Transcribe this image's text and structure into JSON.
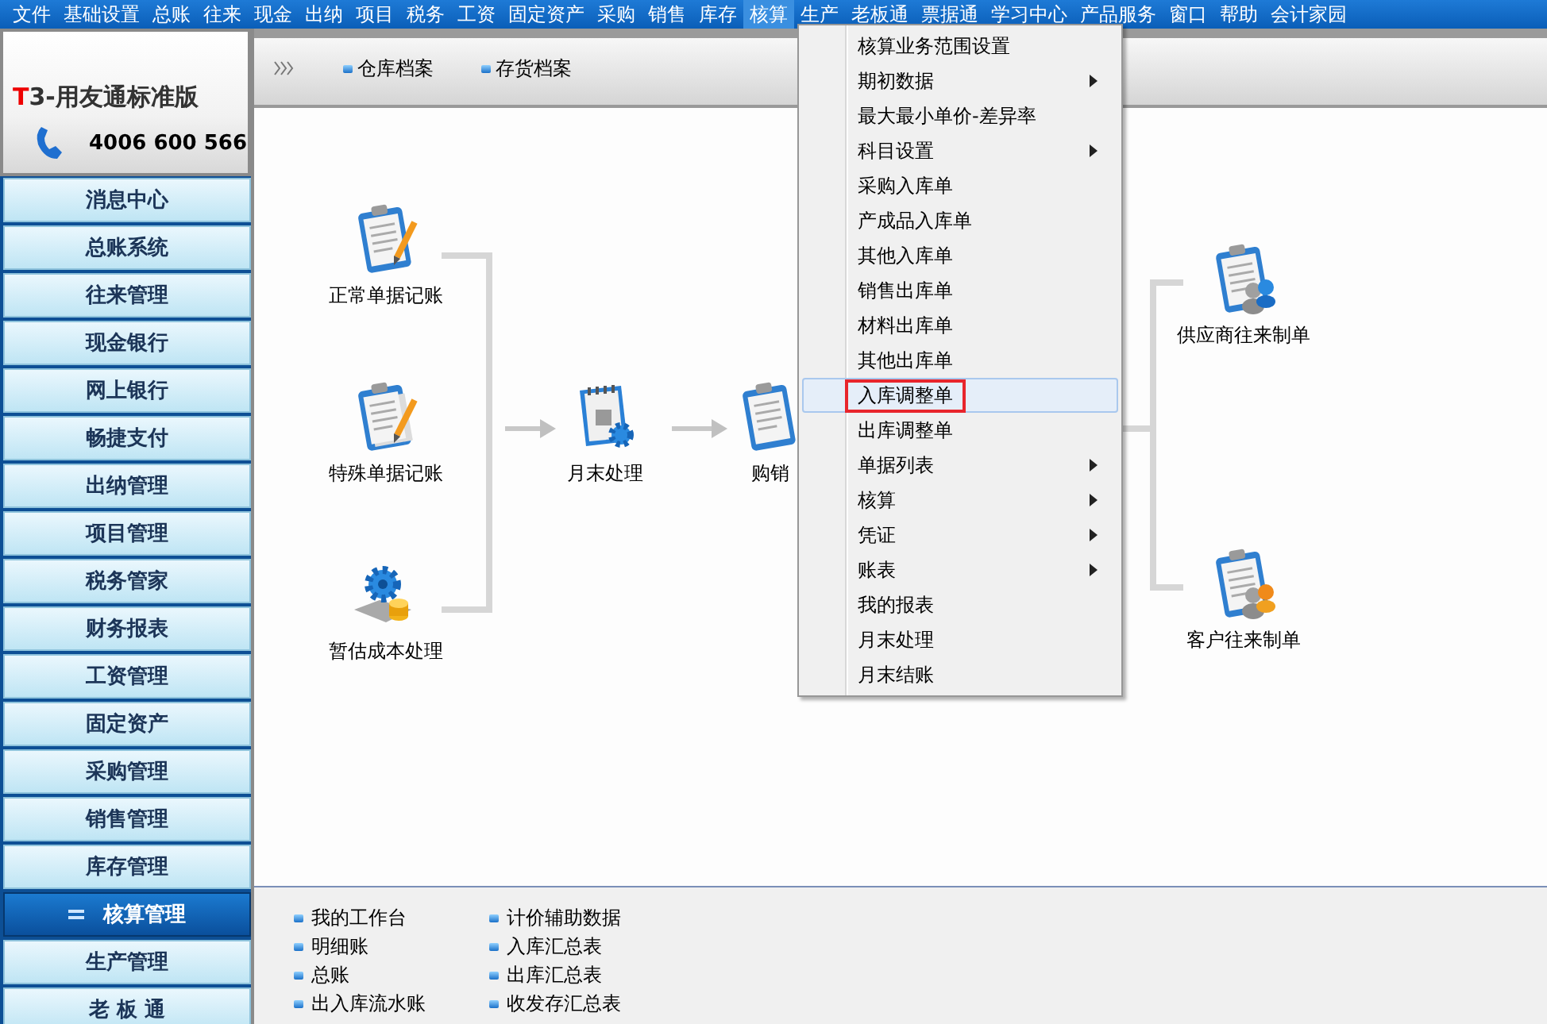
{
  "menu_bar": [
    {
      "label": "文件",
      "selected": false
    },
    {
      "label": "基础设置",
      "selected": false
    },
    {
      "label": "总账",
      "selected": false
    },
    {
      "label": "往来",
      "selected": false
    },
    {
      "label": "现金",
      "selected": false
    },
    {
      "label": "出纳",
      "selected": false
    },
    {
      "label": "项目",
      "selected": false
    },
    {
      "label": "税务",
      "selected": false
    },
    {
      "label": "工资",
      "selected": false
    },
    {
      "label": "固定资产",
      "selected": false
    },
    {
      "label": "采购",
      "selected": false
    },
    {
      "label": "销售",
      "selected": false
    },
    {
      "label": "库存",
      "selected": false
    },
    {
      "label": "核算",
      "selected": true
    },
    {
      "label": "生产",
      "selected": false
    },
    {
      "label": "老板通",
      "selected": false
    },
    {
      "label": "票据通",
      "selected": false
    },
    {
      "label": "学习中心",
      "selected": false
    },
    {
      "label": "产品服务",
      "selected": false
    },
    {
      "label": "窗口",
      "selected": false
    },
    {
      "label": "帮助",
      "selected": false
    },
    {
      "label": "会计家园",
      "selected": false
    }
  ],
  "logo": {
    "mark": "T",
    "name": "3-用友通标准版",
    "phone": "4006 600 566"
  },
  "sidebar": {
    "items": [
      {
        "label": "消息中心",
        "selected": false
      },
      {
        "label": "总账系统",
        "selected": false
      },
      {
        "label": "往来管理",
        "selected": false
      },
      {
        "label": "现金银行",
        "selected": false
      },
      {
        "label": "网上银行",
        "selected": false
      },
      {
        "label": "畅捷支付",
        "selected": false
      },
      {
        "label": "出纳管理",
        "selected": false
      },
      {
        "label": "项目管理",
        "selected": false
      },
      {
        "label": "税务管家",
        "selected": false
      },
      {
        "label": "财务报表",
        "selected": false
      },
      {
        "label": "工资管理",
        "selected": false
      },
      {
        "label": "固定资产",
        "selected": false
      },
      {
        "label": "采购管理",
        "selected": false
      },
      {
        "label": "销售管理",
        "selected": false
      },
      {
        "label": "库存管理",
        "selected": false
      },
      {
        "label": "核算管理",
        "selected": true
      },
      {
        "label": "生产管理",
        "selected": false
      },
      {
        "label": "老 板 通",
        "selected": false
      }
    ]
  },
  "toolbar": {
    "links": [
      "仓库档案",
      "存货档案"
    ]
  },
  "flow": {
    "sources": [
      {
        "label": "正常单据记账",
        "kind": "entry"
      },
      {
        "label": "特殊单据记账",
        "kind": "special"
      },
      {
        "label": "暂估成本处理",
        "kind": "estimate"
      }
    ],
    "middle": [
      {
        "label": "月末处理",
        "kind": "monthend"
      },
      {
        "label": "购销",
        "kind": "sales"
      }
    ],
    "targets": [
      {
        "label": "供应商往来制单",
        "kind": "supplier"
      },
      {
        "label": "客户往来制单",
        "kind": "customer"
      }
    ]
  },
  "dropdown": {
    "items": [
      {
        "label": "核算业务范围设置",
        "submenu": false,
        "selected": false
      },
      {
        "label": "期初数据",
        "submenu": true,
        "selected": false
      },
      {
        "label": "最大最小单价-差异率",
        "submenu": false,
        "selected": false
      },
      {
        "label": "科目设置",
        "submenu": true,
        "selected": false
      },
      {
        "label": "采购入库单",
        "submenu": false,
        "selected": false
      },
      {
        "label": "产成品入库单",
        "submenu": false,
        "selected": false
      },
      {
        "label": "其他入库单",
        "submenu": false,
        "selected": false
      },
      {
        "label": "销售出库单",
        "submenu": false,
        "selected": false
      },
      {
        "label": "材料出库单",
        "submenu": false,
        "selected": false
      },
      {
        "label": "其他出库单",
        "submenu": false,
        "selected": false
      },
      {
        "label": "入库调整单",
        "submenu": false,
        "selected": true
      },
      {
        "label": "出库调整单",
        "submenu": false,
        "selected": false
      },
      {
        "label": "单据列表",
        "submenu": true,
        "selected": false
      },
      {
        "label": "核算",
        "submenu": true,
        "selected": false
      },
      {
        "label": "凭证",
        "submenu": true,
        "selected": false
      },
      {
        "label": "账表",
        "submenu": true,
        "selected": false
      },
      {
        "label": "我的报表",
        "submenu": false,
        "selected": false
      },
      {
        "label": "月末处理",
        "submenu": false,
        "selected": false
      },
      {
        "label": "月末结账",
        "submenu": false,
        "selected": false
      }
    ]
  },
  "bottom_links": [
    [
      "我的工作台",
      "明细账",
      "总账",
      "出入库流水账"
    ],
    [
      "计价辅助数据",
      "入库汇总表",
      "出库汇总表",
      "收发存汇总表"
    ]
  ]
}
